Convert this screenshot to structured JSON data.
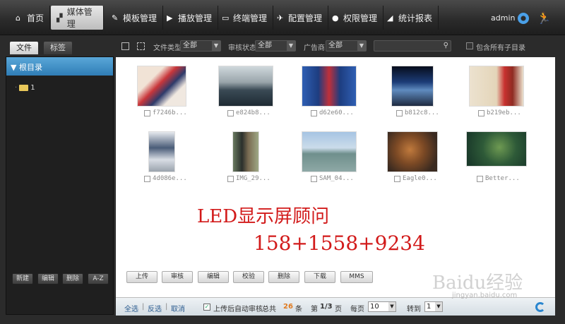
{
  "nav": {
    "items": [
      {
        "label": "首页",
        "icon": "home-icon"
      },
      {
        "label": "媒体管理",
        "icon": "media-icon"
      },
      {
        "label": "模板管理",
        "icon": "template-icon"
      },
      {
        "label": "播放管理",
        "icon": "play-icon"
      },
      {
        "label": "终端管理",
        "icon": "terminal-icon"
      },
      {
        "label": "配置管理",
        "icon": "config-icon"
      },
      {
        "label": "权限管理",
        "icon": "permission-icon"
      },
      {
        "label": "统计报表",
        "icon": "report-icon"
      }
    ],
    "active_index": 1,
    "user": "admin"
  },
  "left_tabs": {
    "files": "文件",
    "tags": "标签"
  },
  "filters": {
    "file_type_label": "文件类型",
    "file_type_value": "全部",
    "review_label": "审核状态",
    "review_value": "全部",
    "advertiser_label": "广告商",
    "advertiser_value": "全部",
    "include_sub_label": "包含所有子目录"
  },
  "sidebar": {
    "root": "根目录",
    "tree": [
      {
        "label": "1"
      }
    ],
    "buttons": {
      "new": "新建",
      "edit": "编辑",
      "delete": "删除",
      "sort": "A-Z"
    }
  },
  "media": [
    {
      "name": "f7246b..."
    },
    {
      "name": "e824b8..."
    },
    {
      "name": "d62e60..."
    },
    {
      "name": "b812c8..."
    },
    {
      "name": "b219eb..."
    },
    {
      "name": "4d086e..."
    },
    {
      "name": "IMG_29..."
    },
    {
      "name": "SAM_04..."
    },
    {
      "name": "Eagle0..."
    },
    {
      "name": "Better..."
    }
  ],
  "watermark": {
    "line1": "LED显示屏顾问",
    "line2": "158+1558+9234"
  },
  "actions": {
    "upload": "上传",
    "review": "审核",
    "edit": "编辑",
    "verify": "校验",
    "delete": "删除",
    "download": "下载",
    "mms": "MMS"
  },
  "pager": {
    "select_all": "全选",
    "invert": "反选",
    "cancel": "取消",
    "auto_review": "上传后自动审核",
    "total_prefix": "总共",
    "total": "26",
    "total_unit": "条",
    "page_prefix": "第",
    "page": "1/3",
    "page_unit": "页",
    "per_page_label": "每页",
    "per_page": "10",
    "goto_label": "转到",
    "goto_page": "1"
  },
  "baidu_watermark": {
    "text": "Baidu经验",
    "sub": "jingyan.baidu.com"
  },
  "colors": {
    "accent": "#2f7db6",
    "watermark": "#d21a1a"
  }
}
